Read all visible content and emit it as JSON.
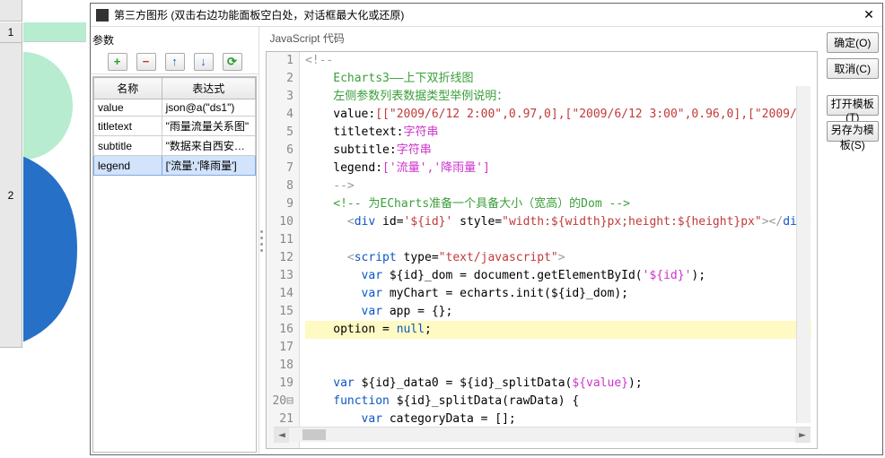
{
  "leftSheet": {
    "row1": "1",
    "row2": "2"
  },
  "dialog": {
    "title": "第三方图形    (双击右边功能面板空白处，对话框最大化或还原)"
  },
  "paramsPanel": {
    "label": "参数",
    "toolbar": {
      "add": "+",
      "remove": "−",
      "up": "↑",
      "down": "↓",
      "refresh": "⟳"
    },
    "headers": {
      "name": "名称",
      "expr": "表达式"
    },
    "rows": [
      {
        "name": "value",
        "expr": "json@a(\"ds1\")"
      },
      {
        "name": "titletext",
        "expr": "\"雨量流量关系图\""
      },
      {
        "name": "subtitle",
        "expr": "\"数据来自西安兰特水电..."
      },
      {
        "name": "legend",
        "expr": "['流量','降雨量']"
      }
    ],
    "selectedIndex": 3
  },
  "codePanel": {
    "header": "JavaScript 代码",
    "highlightLine": 16,
    "lines": [
      {
        "n": "1",
        "tokens": [
          {
            "t": "<!--",
            "c": "c-grey"
          }
        ]
      },
      {
        "n": "2",
        "tokens": [
          {
            "t": "    Echarts3——上下双折线图",
            "c": "c-green"
          }
        ]
      },
      {
        "n": "3",
        "tokens": [
          {
            "t": "    左侧参数列表数据类型举例说明：",
            "c": "c-green"
          }
        ]
      },
      {
        "n": "4",
        "tokens": [
          {
            "t": "    value:",
            "c": ""
          },
          {
            "t": "[[\"2009/6/12 2:00\",0.97,0],[\"2009/6/12 3:00\",0.96,0],[\"2009/",
            "c": "c-red"
          }
        ]
      },
      {
        "n": "5",
        "tokens": [
          {
            "t": "    titletext:",
            "c": ""
          },
          {
            "t": "字符串",
            "c": "c-mag"
          }
        ]
      },
      {
        "n": "6",
        "tokens": [
          {
            "t": "    subtitle:",
            "c": ""
          },
          {
            "t": "字符串",
            "c": "c-mag"
          }
        ]
      },
      {
        "n": "7",
        "tokens": [
          {
            "t": "    legend:",
            "c": ""
          },
          {
            "t": "['流量','降雨量']",
            "c": "c-mag"
          }
        ]
      },
      {
        "n": "8",
        "tokens": [
          {
            "t": "    -->",
            "c": "c-grey"
          }
        ]
      },
      {
        "n": "9",
        "tokens": [
          {
            "t": "    <!-- 为ECharts准备一个具备大小（宽高）的Dom -->",
            "c": "c-green"
          }
        ]
      },
      {
        "n": "10",
        "tokens": [
          {
            "t": "      <",
            "c": "c-grey"
          },
          {
            "t": "div ",
            "c": "c-blue"
          },
          {
            "t": "id=",
            "c": ""
          },
          {
            "t": "'${id}'",
            "c": "c-red"
          },
          {
            "t": " style=",
            "c": ""
          },
          {
            "t": "\"width:${width}px;height:${height}px\"",
            "c": "c-red"
          },
          {
            "t": "></",
            "c": "c-grey"
          },
          {
            "t": "div",
            "c": "c-blue"
          },
          {
            "t": ">",
            "c": "c-grey"
          }
        ]
      },
      {
        "n": "11",
        "tokens": [
          {
            "t": " ",
            "c": ""
          }
        ]
      },
      {
        "n": "12",
        "tokens": [
          {
            "t": "      <",
            "c": "c-grey"
          },
          {
            "t": "script ",
            "c": "c-blue"
          },
          {
            "t": "type=",
            "c": ""
          },
          {
            "t": "\"text/javascript\"",
            "c": "c-red"
          },
          {
            "t": ">",
            "c": "c-grey"
          }
        ]
      },
      {
        "n": "13",
        "tokens": [
          {
            "t": "        var ",
            "c": "c-blue"
          },
          {
            "t": "${id}_dom = document.getElementById(",
            "c": ""
          },
          {
            "t": "'${id}'",
            "c": "c-mag"
          },
          {
            "t": ");",
            "c": ""
          }
        ]
      },
      {
        "n": "14",
        "tokens": [
          {
            "t": "        var ",
            "c": "c-blue"
          },
          {
            "t": "myChart = echarts.init(${id}_dom);",
            "c": ""
          }
        ]
      },
      {
        "n": "15",
        "tokens": [
          {
            "t": "        var ",
            "c": "c-blue"
          },
          {
            "t": "app = {};",
            "c": ""
          }
        ]
      },
      {
        "n": "16",
        "tokens": [
          {
            "t": "    option = ",
            "c": ""
          },
          {
            "t": "null",
            "c": "c-blue"
          },
          {
            "t": ";",
            "c": ""
          }
        ]
      },
      {
        "n": "17",
        "tokens": [
          {
            "t": " ",
            "c": ""
          }
        ]
      },
      {
        "n": "18",
        "tokens": [
          {
            "t": " ",
            "c": ""
          }
        ]
      },
      {
        "n": "19",
        "tokens": [
          {
            "t": "    var ",
            "c": "c-blue"
          },
          {
            "t": "${id}_data0 = ${id}_splitData(",
            "c": ""
          },
          {
            "t": "${value}",
            "c": "c-mag"
          },
          {
            "t": ");",
            "c": ""
          }
        ]
      },
      {
        "n": "20⊟",
        "tokens": [
          {
            "t": "    function ",
            "c": "c-blue"
          },
          {
            "t": "${id}_splitData(rawData) {",
            "c": ""
          }
        ]
      },
      {
        "n": "21",
        "tokens": [
          {
            "t": "        var ",
            "c": "c-blue"
          },
          {
            "t": "categoryData = [];",
            "c": ""
          }
        ]
      }
    ]
  },
  "buttons": {
    "ok": "确定(O)",
    "cancel": "取消(C)",
    "openTpl": "打开模板(T)",
    "saveTpl": "另存为模板(S)"
  }
}
